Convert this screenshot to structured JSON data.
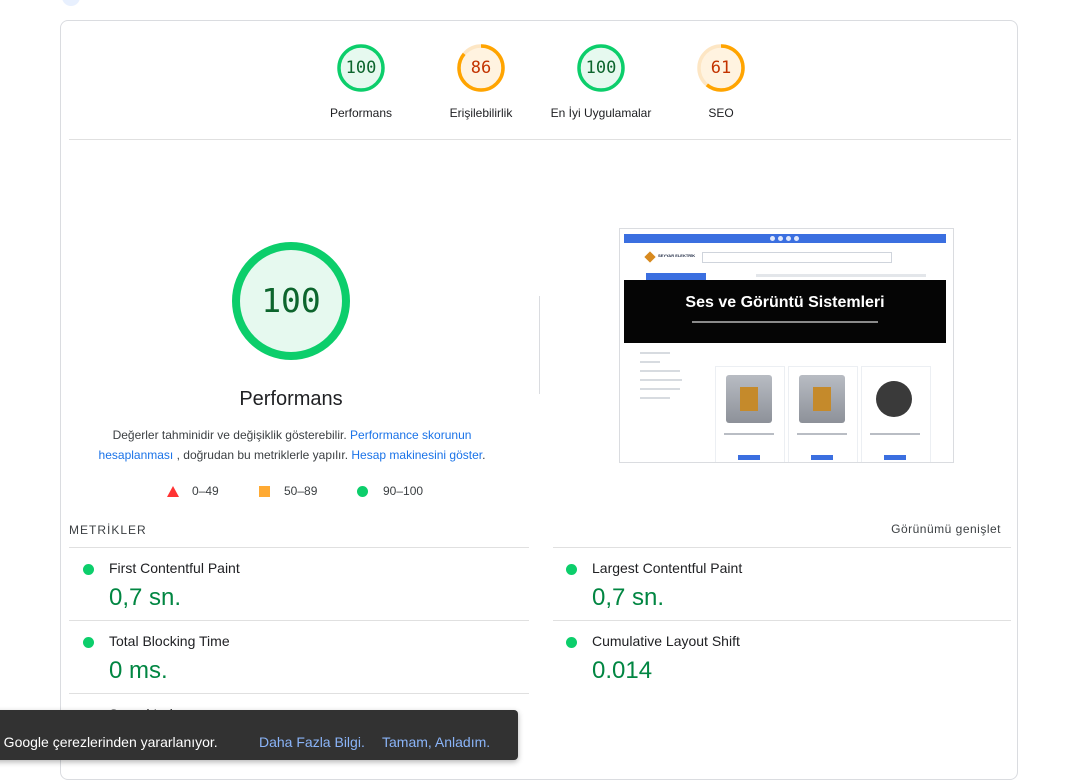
{
  "colors": {
    "pass": "#0cce6b",
    "average": "#ffa400",
    "fail": "#ff4e42",
    "pass_text": "#018642",
    "link": "#1a73e8"
  },
  "gauges": [
    {
      "score": "100",
      "label": "Performans",
      "level": "pass"
    },
    {
      "score": "86",
      "label": "Erişilebilirlik",
      "level": "average"
    },
    {
      "score": "100",
      "label": "En İyi Uygulamalar",
      "level": "pass"
    },
    {
      "score": "61",
      "label": "SEO",
      "level": "average"
    }
  ],
  "performance": {
    "score": "100",
    "title": "Performans",
    "note_prefix": "Değerler tahminidir ve değişiklik gösterebilir.",
    "note_link1": "Performance skorunun hesaplanması",
    "note_middle": ", doğrudan bu metriklerle yapılır.",
    "note_link2": "Hesap makinesini göster",
    "note_suffix": "."
  },
  "legend": {
    "fail": "0–49",
    "average": "50–89",
    "pass": "90–100"
  },
  "screenshot": {
    "hero_title": "Ses ve Görüntü Sistemleri",
    "brand": "SEYYAR ELEKTRİK"
  },
  "metrics_header": "METRİKLER",
  "expand_label": "Görünümü genişlet",
  "metrics": [
    {
      "name": "First Contentful Paint",
      "value": "0,7 sn."
    },
    {
      "name": "Largest Contentful Paint",
      "value": "0,7 sn."
    },
    {
      "name": "Total Blocking Time",
      "value": "0 ms."
    },
    {
      "name": "Cumulative Layout Shift",
      "value": "0.014"
    },
    {
      "name": "Speed Index",
      "value": ""
    }
  ],
  "cookie": {
    "message": "n Google çerezlerinden yararlanıyor.",
    "more_info": "Daha Fazla Bilgi.",
    "ok": "Tamam, Anladım."
  }
}
